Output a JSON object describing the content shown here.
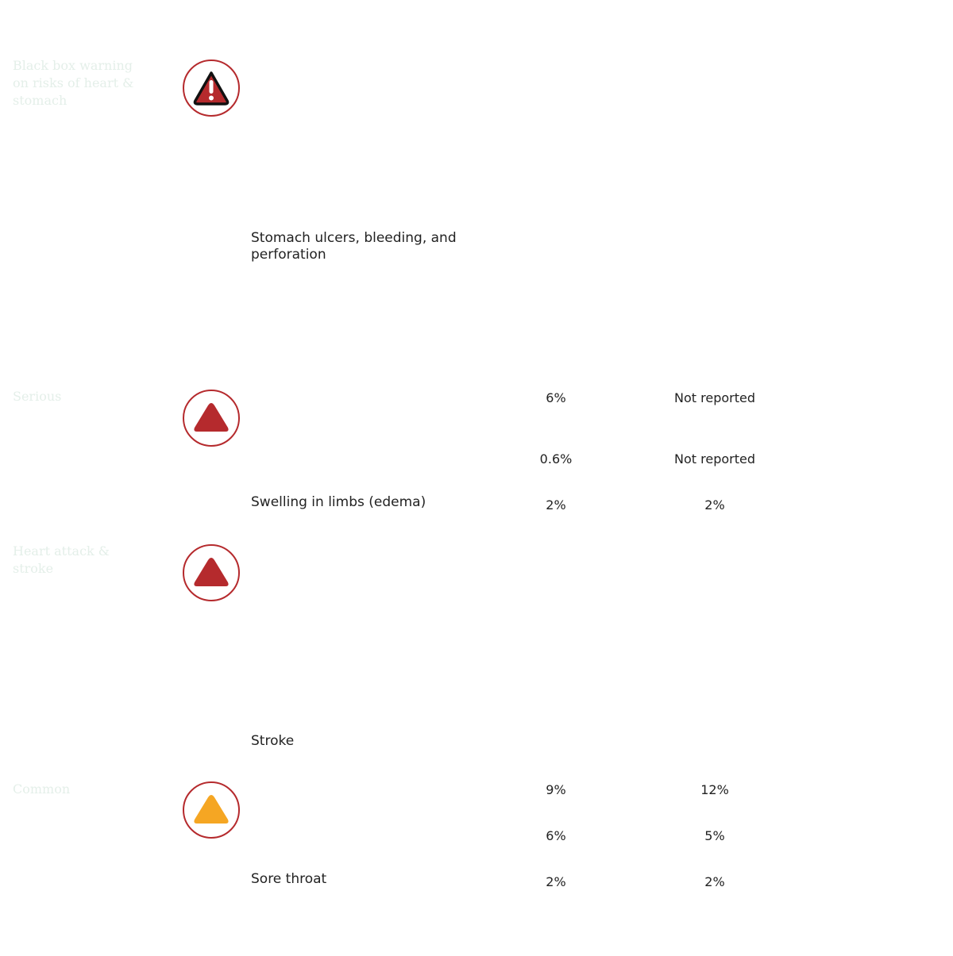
{
  "groups": [
    {
      "category": "Black box warning on risks of heart & stomach",
      "icon": "exclamation-warning-icon",
      "icon_color": "#b52a2d",
      "rows": [
        {
          "label": "Stomach ulcers, bleeding, and perforation",
          "col_a": "",
          "col_b": ""
        }
      ]
    },
    {
      "category": "Serious",
      "icon": "triangle-red-icon",
      "icon_color": "#b52a2d",
      "rows": [
        {
          "label": "",
          "col_a": "6%",
          "col_b": "Not reported"
        },
        {
          "label": "",
          "col_a": "0.6%",
          "col_b": "Not reported"
        },
        {
          "label": "Swelling in limbs (edema)",
          "col_a": "2%",
          "col_b": "2%"
        }
      ]
    },
    {
      "category": "Heart attack & stroke",
      "icon": "triangle-red-icon",
      "icon_color": "#b52a2d",
      "rows": [
        {
          "label": "Stroke",
          "col_a": "",
          "col_b": ""
        }
      ]
    },
    {
      "category": "Common",
      "icon": "triangle-orange-icon",
      "icon_color": "#f5a623",
      "rows": [
        {
          "label": "",
          "col_a": "9%",
          "col_b": "12%"
        },
        {
          "label": "",
          "col_a": "6%",
          "col_b": "5%"
        },
        {
          "label": "Sore throat",
          "col_a": "2%",
          "col_b": "2%"
        }
      ]
    }
  ]
}
